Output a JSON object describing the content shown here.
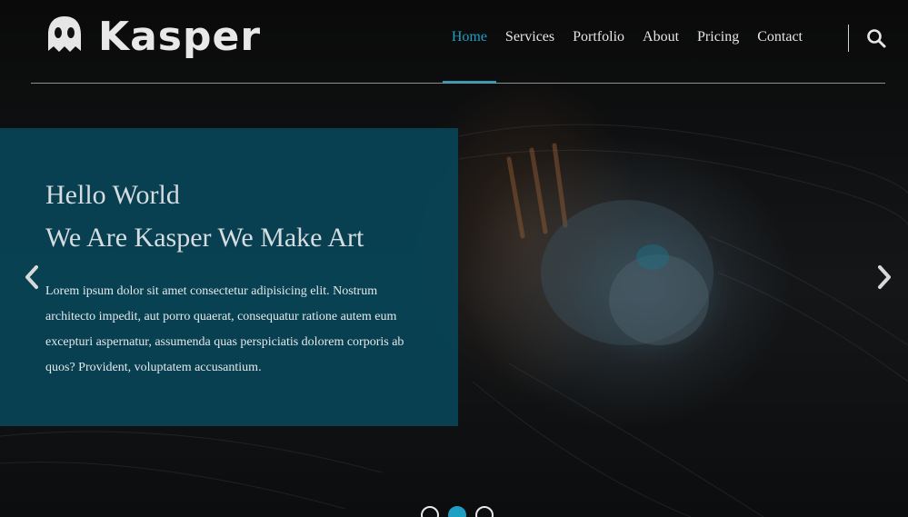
{
  "brand": {
    "name": "Kasper"
  },
  "nav": {
    "items": [
      "Home",
      "Services",
      "Portfolio",
      "About",
      "Pricing",
      "Contact"
    ],
    "active": "Home",
    "search_icon": "search-icon"
  },
  "hero": {
    "heading_line1": "Hello World",
    "heading_line2": "We Are Kasper We Make Art",
    "paragraph": "Lorem ipsum dolor sit amet consectetur adipisicing elit. Nostrum architecto impedit, aut porro quaerat, consequatur ratione autem eum excepturi aspernatur, assumenda quas perspiciatis dolorem corporis ab quos? Provident, voluptatem accusantium.",
    "prev_icon": "chevron-left-icon",
    "next_icon": "chevron-right-icon"
  },
  "slider": {
    "count": 3,
    "active_index": 1
  },
  "colors": {
    "accent": "#1ea0c5",
    "panel": "#07485c",
    "text": "#e6e6e6"
  }
}
